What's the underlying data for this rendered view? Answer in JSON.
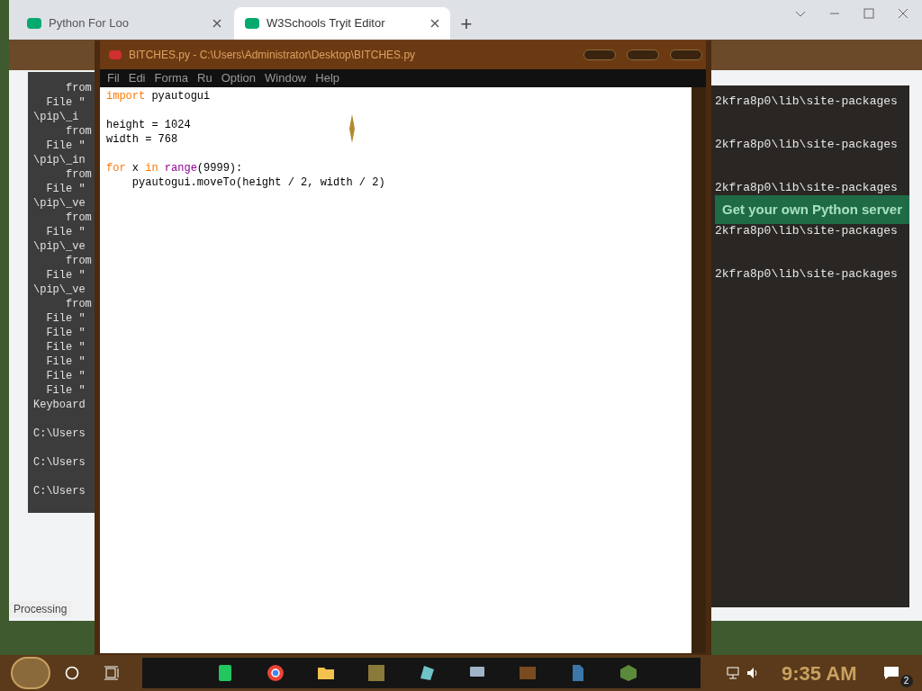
{
  "browser": {
    "tabs": [
      {
        "label": "Python For Loo",
        "selected": false
      },
      {
        "label": "W3Schools Tryit Editor",
        "selected": true
      }
    ],
    "new_tab": "+",
    "banner": "Get your own Python server",
    "status": "Processing"
  },
  "console_left": {
    "lines": [
      {
        "text": "     from",
        "gap_before": false
      },
      {
        "text": "  File \"",
        "gap_before": false
      },
      {
        "text": "\\pip\\_i",
        "gap_before": false
      },
      {
        "text": "     from",
        "gap_before": false
      },
      {
        "text": "  File \"",
        "gap_before": false
      },
      {
        "text": "\\pip\\_in",
        "gap_before": false
      },
      {
        "text": "     from",
        "gap_before": false
      },
      {
        "text": "  File \"",
        "gap_before": false
      },
      {
        "text": "\\pip\\_ve",
        "gap_before": false
      },
      {
        "text": "     from",
        "gap_before": false
      },
      {
        "text": "  File \"",
        "gap_before": false
      },
      {
        "text": "\\pip\\_ve",
        "gap_before": false
      },
      {
        "text": "     from",
        "gap_before": false
      },
      {
        "text": "  File \"",
        "gap_before": false
      },
      {
        "text": "\\pip\\_ve",
        "gap_before": false
      },
      {
        "text": "     from",
        "gap_before": false
      },
      {
        "text": "  File \"",
        "gap_before": false
      },
      {
        "text": "  File \"",
        "gap_before": false
      },
      {
        "text": "  File \"",
        "gap_before": false
      },
      {
        "text": "  File \"",
        "gap_before": false
      },
      {
        "text": "  File \"",
        "gap_before": false
      },
      {
        "text": "  File \"",
        "gap_before": false
      },
      {
        "text": "Keyboard",
        "gap_before": false
      },
      {
        "text": "C:\\Users",
        "gap_before": true
      },
      {
        "text": "C:\\Users",
        "gap_before": true
      },
      {
        "text": "C:\\Users",
        "gap_before": true
      }
    ]
  },
  "editor": {
    "title": "BITCHES.py - C:\\Users\\Administrator\\Desktop\\BITCHES.py",
    "menu": [
      "Fil",
      "Edi",
      "Forma",
      "Ru",
      "Option",
      "Window",
      "Help"
    ],
    "lines": [
      {
        "gap_before": false,
        "tokens": [
          {
            "text": "import",
            "kind": "keyword"
          },
          {
            "text": " pyautogui",
            "kind": "plain"
          }
        ]
      },
      {
        "gap_before": true,
        "tokens": [
          {
            "text": "height = 1024",
            "kind": "plain"
          }
        ]
      },
      {
        "gap_before": false,
        "tokens": [
          {
            "text": "width = 768",
            "kind": "plain"
          }
        ]
      },
      {
        "gap_before": true,
        "tokens": [
          {
            "text": "for",
            "kind": "keyword"
          },
          {
            "text": " x ",
            "kind": "plain"
          },
          {
            "text": "in",
            "kind": "keyword"
          },
          {
            "text": " range",
            "kind": "builtin"
          },
          {
            "text": "(9999):",
            "kind": "plain"
          }
        ]
      },
      {
        "gap_before": false,
        "tokens": [
          {
            "text": "    pyautogui.moveTo(height / 2, width / 2)",
            "kind": "plain"
          }
        ]
      }
    ]
  },
  "console_right": {
    "lines": [
      "2kfra8p0\\lib\\site-packages",
      "2kfra8p0\\lib\\site-packages",
      "2kfra8p0\\lib\\site-packages",
      "2kfra8p0\\lib\\site-packages",
      "2kfra8p0\\lib\\site-packages"
    ]
  },
  "taskbar": {
    "apps": [
      {
        "kind": "sheets",
        "color": "#22c55e"
      },
      {
        "kind": "chrome",
        "color": "#ea4335"
      },
      {
        "kind": "folder",
        "color": "#f2c14e"
      },
      {
        "kind": "game",
        "color": "#8a7a3a"
      },
      {
        "kind": "glass",
        "color": "#6fc3c8"
      },
      {
        "kind": "monitor",
        "color": "#a0b4c8"
      },
      {
        "kind": "calendar",
        "color": "#7a4a20"
      },
      {
        "kind": "python",
        "color": "#3b77a8"
      },
      {
        "kind": "block",
        "color": "#5a8a3a"
      }
    ],
    "time": "9:35 AM",
    "notifications": "2"
  }
}
